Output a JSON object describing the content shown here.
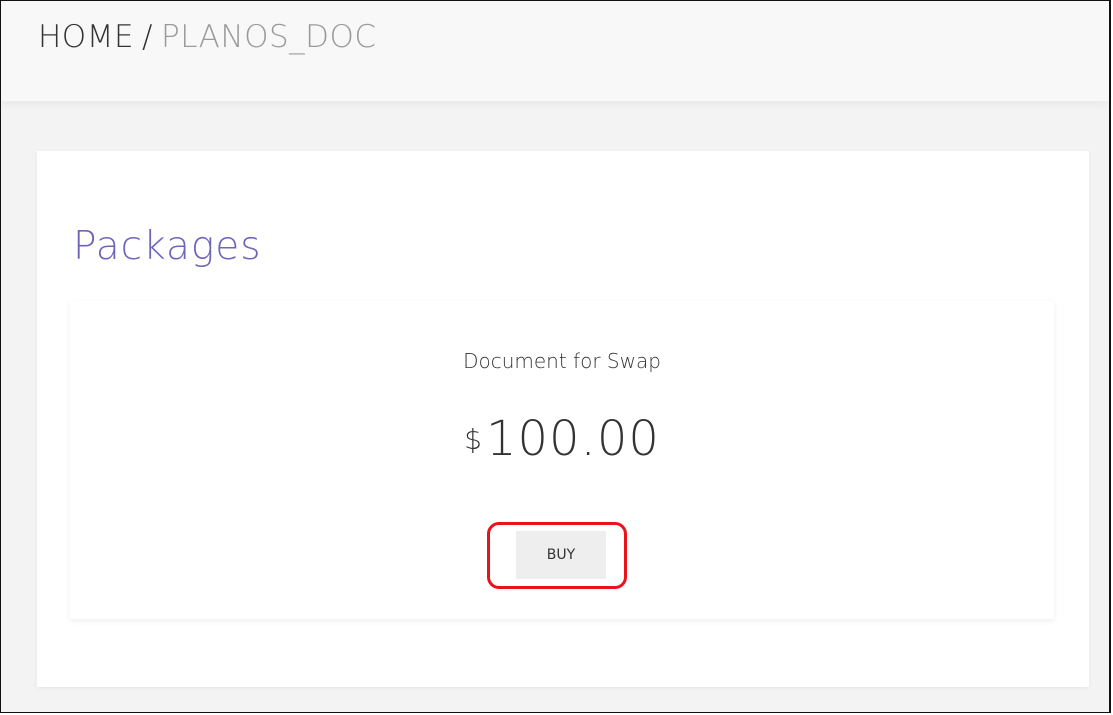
{
  "breadcrumb": {
    "home": "HOME",
    "separator": "/",
    "current": "PLANOS_DOC"
  },
  "packages": {
    "title": "Packages",
    "items": [
      {
        "name": "Document for Swap",
        "currency": "$",
        "price": "100.00",
        "buy_label": "BUY"
      }
    ]
  },
  "colors": {
    "title_accent": "#6d65b9",
    "highlight": "#e8141a"
  }
}
